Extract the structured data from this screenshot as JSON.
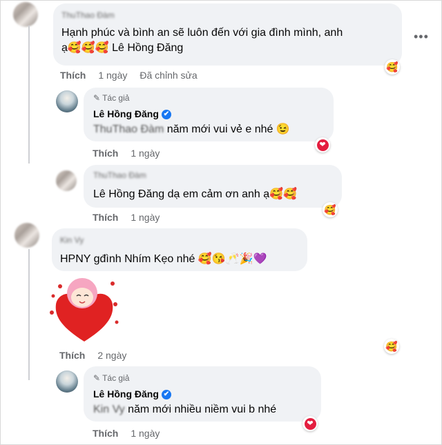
{
  "comments": [
    {
      "name": "ThuThao Đàm",
      "text": "Hạnh phúc và bình an sẽ luôn đến với gia đình mình, anh ạ🥰🥰🥰 Lê Hồng Đăng",
      "like": "Thích",
      "time": "1 ngày",
      "edited": "Đã chỉnh sửa",
      "reaction": "🥰"
    },
    {
      "author_badge": "Tác giả",
      "name": "Lê Hồng Đăng",
      "mention": "ThuThao Đàm",
      "text": "năm mới vui vẻ e nhé 😉",
      "like": "Thích",
      "time": "1 ngày",
      "reaction": "❤"
    },
    {
      "name": "ThuThao Đàm",
      "mention": "Lê Hồng Đăng",
      "text": "dạ em cảm ơn anh ạ🥰🥰",
      "like": "Thích",
      "time": "1 ngày",
      "reaction": "🥰"
    },
    {
      "name": "Kin Vy",
      "text": "HPNY gđình Nhím Kẹo nhé 🥰😘🥂🎉💜",
      "like": "Thích",
      "time": "2 ngày",
      "reaction": "🥰"
    },
    {
      "author_badge": "Tác giả",
      "name": "Lê Hồng Đăng",
      "mention": "Kin Vy",
      "text": "năm mới nhiều niềm vui b nhé",
      "like": "Thích",
      "time": "1 ngày",
      "reaction": "❤"
    }
  ],
  "icons": {
    "verified": "✔",
    "more": "more-options-icon",
    "pen": "✎"
  }
}
